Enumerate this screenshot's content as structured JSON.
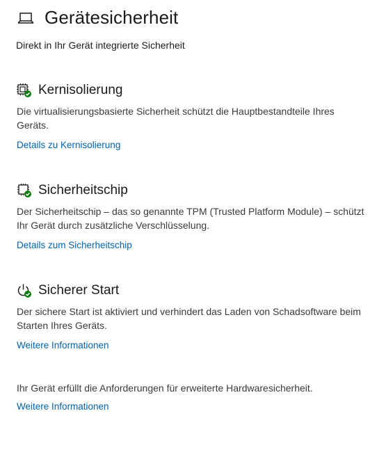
{
  "header": {
    "title": "Gerätesicherheit",
    "subtitle": "Direkt in Ihr Gerät integrierte Sicherheit",
    "icon": "laptop-icon"
  },
  "sections": [
    {
      "icon": "core-isolation-icon",
      "title": "Kernisolierung",
      "description": "Die virtualisierungsbasierte Sicherheit schützt die Hauptbestandteile Ihres Geräts.",
      "link": "Details zu Kernisolierung"
    },
    {
      "icon": "security-chip-icon",
      "title": "Sicherheitschip",
      "description": "Der Sicherheitschip – das so genannte TPM (Trusted Platform Module) – schützt Ihr Gerät durch zusätzliche Verschlüsselung.",
      "link": "Details zum Sicherheitschip"
    },
    {
      "icon": "secure-boot-icon",
      "title": "Sicherer Start",
      "description": "Der sichere Start ist aktiviert und verhindert das Laden von Schadsoftware beim Starten Ihres Geräts.",
      "link": "Weitere Informationen"
    }
  ],
  "footer": {
    "text": "Ihr Gerät erfüllt die Anforderungen für erweiterte Hardwaresicherheit.",
    "link": "Weitere Informationen"
  },
  "colors": {
    "link": "#0063b1",
    "status_ok": "#107c10",
    "text": "#1a1a1a"
  }
}
